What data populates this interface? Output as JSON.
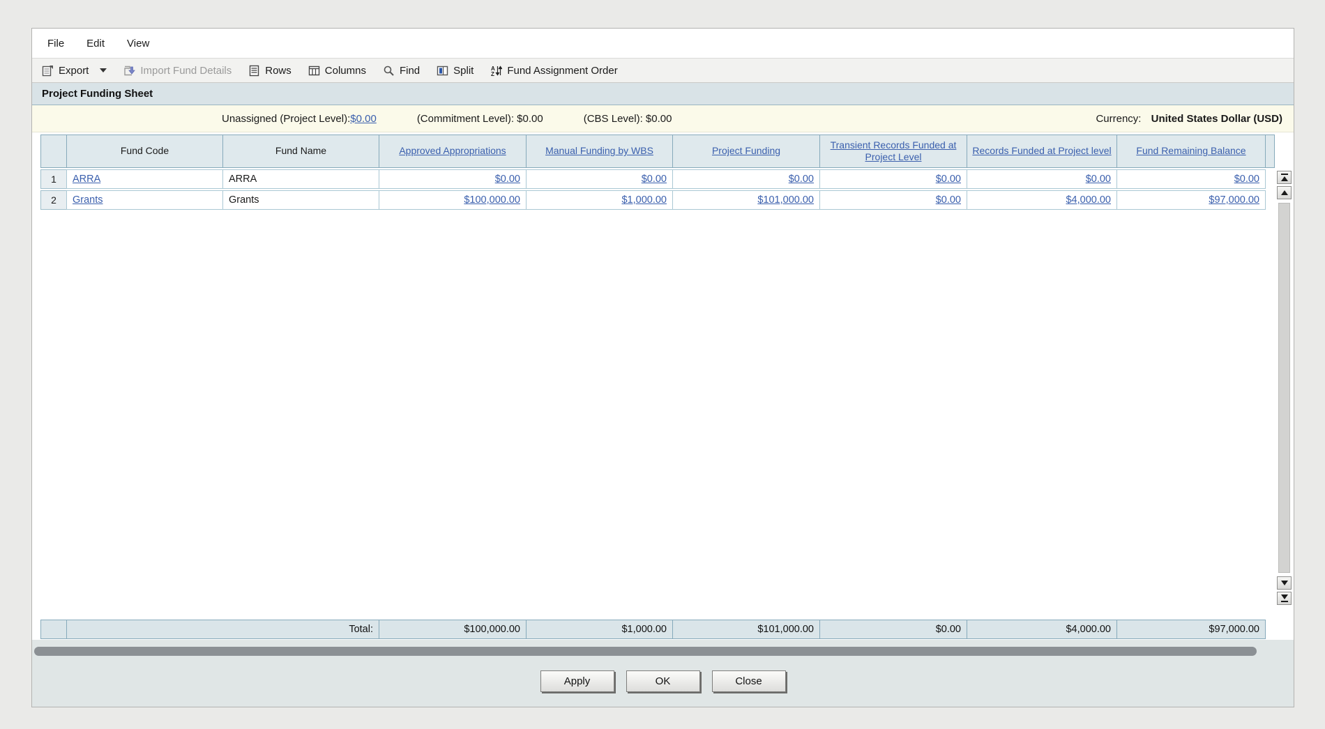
{
  "menu": {
    "items": [
      "File",
      "Edit",
      "View"
    ]
  },
  "toolbar": {
    "export_label": "Export",
    "import_label": "Import Fund Details",
    "rows_label": "Rows",
    "columns_label": "Columns",
    "find_label": "Find",
    "split_label": "Split",
    "fund_assignment_order_label": "Fund Assignment Order"
  },
  "header": {
    "title": "Project Funding Sheet"
  },
  "info": {
    "unassigned_label": "Unassigned (Project Level):",
    "unassigned_value": "$0.00",
    "commitment_label": "(Commitment Level): $0.00",
    "cbs_label": "(CBS Level): $0.00",
    "currency_label": "Currency:",
    "currency_value": "United States Dollar (USD)"
  },
  "table": {
    "columns": [
      "Fund Code",
      "Fund Name",
      "Approved Appropriations",
      "Manual Funding by WBS",
      "Project Funding",
      "Transient Records Funded at Project Level",
      "Records Funded at Project level",
      "Fund Remaining Balance"
    ],
    "rows": [
      {
        "num": "1",
        "fund_code": "ARRA",
        "fund_name": "ARRA",
        "approved": "$0.00",
        "manual": "$0.00",
        "project": "$0.00",
        "transient": "$0.00",
        "records": "$0.00",
        "remaining": "$0.00"
      },
      {
        "num": "2",
        "fund_code": "Grants",
        "fund_name": "Grants",
        "approved": "$100,000.00",
        "manual": "$1,000.00",
        "project": "$101,000.00",
        "transient": "$0.00",
        "records": "$4,000.00",
        "remaining": "$97,000.00"
      }
    ],
    "total": {
      "label": "Total:",
      "approved": "$100,000.00",
      "manual": "$1,000.00",
      "project": "$101,000.00",
      "transient": "$0.00",
      "records": "$4,000.00",
      "remaining": "$97,000.00"
    }
  },
  "footer": {
    "apply_label": "Apply",
    "ok_label": "OK",
    "close_label": "Close"
  },
  "colors": {
    "link": "#3a5fad",
    "header_bg": "#dfe9ed",
    "title_bg": "#d9e3e7",
    "info_bg": "#fbfaea",
    "total_bg": "#dae5e9",
    "grid_border": "#86aabb",
    "row_border": "#aac8d4",
    "hscroll_thumb": "#8b9094",
    "import_arrow": "#7a86c8"
  }
}
